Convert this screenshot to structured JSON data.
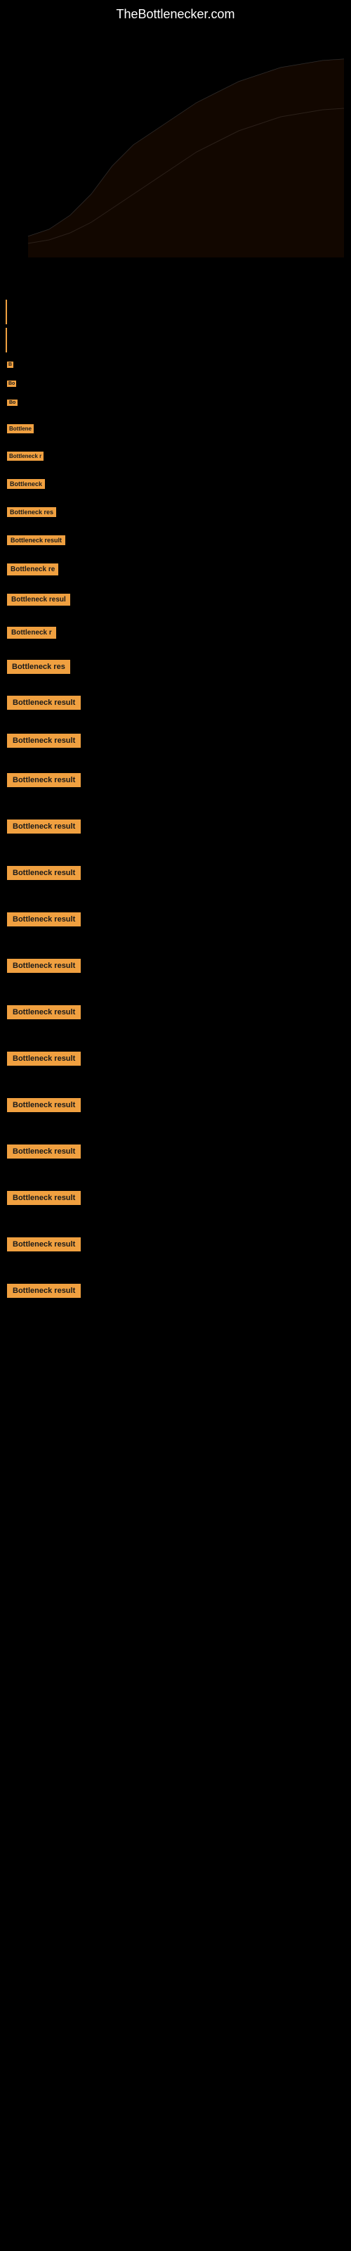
{
  "site": {
    "title": "TheBottlenecker.com"
  },
  "chart": {
    "description": "Bottleneck analysis chart"
  },
  "results": [
    {
      "id": 1,
      "label": "B",
      "size": "tiny",
      "width": 22,
      "marginTop": 1140
    },
    {
      "id": 2,
      "label": "Bo",
      "size": "tiny",
      "width": 22,
      "marginTop": 1200
    },
    {
      "id": 3,
      "label": "Bo",
      "size": "tiny",
      "width": 22,
      "marginTop": 1250
    },
    {
      "id": 4,
      "label": "Bottleneck result",
      "size": "xsmall",
      "width": 28,
      "marginTop": 1310
    },
    {
      "id": 5,
      "label": "Bottleneck result",
      "size": "small",
      "width": 40,
      "marginTop": 1370
    },
    {
      "id": 6,
      "label": "Bottleneck result",
      "size": "small2",
      "width": 52,
      "marginTop": 1430
    },
    {
      "id": 7,
      "label": "Bottleneck result",
      "size": "medium",
      "width": 68,
      "marginTop": 1490
    },
    {
      "id": 8,
      "label": "Bottleneck result",
      "size": "medium2",
      "width": 85,
      "marginTop": 1550
    },
    {
      "id": 9,
      "label": "Bottleneck result",
      "size": "medium3",
      "width": 105,
      "marginTop": 1620
    },
    {
      "id": 10,
      "label": "Bottleneck result",
      "size": "medium4",
      "width": 125,
      "marginTop": 1700
    },
    {
      "id": 11,
      "label": "Bottleneck result",
      "size": "large",
      "width": 150,
      "marginTop": 1780
    },
    {
      "id": 12,
      "label": "Bottleneck result",
      "size": "large2",
      "width": 160,
      "marginTop": 1875
    },
    {
      "id": 13,
      "label": "Bottleneck result",
      "size": "large3",
      "width": 165,
      "marginTop": 1960
    },
    {
      "id": 14,
      "label": "Bottleneck result",
      "size": "full",
      "width": 175,
      "marginTop": 2050
    },
    {
      "id": 15,
      "label": "Bottleneck result",
      "size": "full",
      "width": 175,
      "marginTop": 2177
    },
    {
      "id": 16,
      "label": "Bottleneck result",
      "size": "full",
      "width": 175,
      "marginTop": 2270
    },
    {
      "id": 17,
      "label": "Bottleneck result",
      "size": "full",
      "width": 175,
      "marginTop": 2350
    },
    {
      "id": 18,
      "label": "Bottleneck result",
      "size": "full",
      "width": 175,
      "marginTop": 2440
    },
    {
      "id": 19,
      "label": "Bottleneck result",
      "size": "full",
      "width": 175,
      "marginTop": 2531
    },
    {
      "id": 20,
      "label": "Bottleneck result",
      "size": "full",
      "width": 175,
      "marginTop": 2618
    },
    {
      "id": 21,
      "label": "Bottleneck result",
      "size": "full",
      "width": 175,
      "marginTop": 2705
    },
    {
      "id": 22,
      "label": "Bottleneck result",
      "size": "full",
      "width": 175,
      "marginTop": 2795
    },
    {
      "id": 23,
      "label": "Bottleneck result",
      "size": "full",
      "width": 175,
      "marginTop": 2880
    },
    {
      "id": 24,
      "label": "Bottleneck result",
      "size": "full",
      "width": 175,
      "marginTop": 2972
    },
    {
      "id": 25,
      "label": "Bottleneck result",
      "size": "full",
      "width": 175,
      "marginTop": 3059
    },
    {
      "id": 26,
      "label": "Bottleneck result",
      "size": "full",
      "width": 175,
      "marginTop": 3148
    }
  ]
}
